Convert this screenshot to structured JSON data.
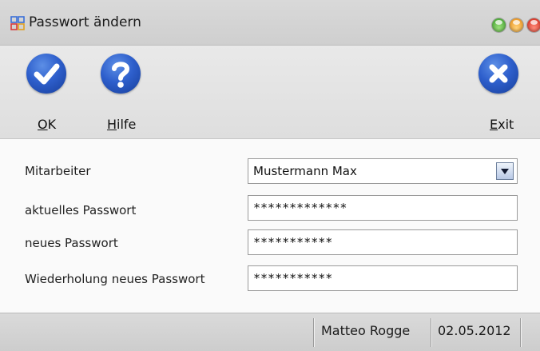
{
  "window": {
    "title": "Passwort ändern"
  },
  "toolbar": {
    "ok": {
      "mnemonic": "O",
      "rest": "K",
      "icon": "checkmark-icon"
    },
    "help": {
      "mnemonic": "H",
      "rest": "ilfe",
      "icon": "question-icon"
    },
    "exit": {
      "mnemonic": "E",
      "rest": "xit",
      "icon": "close-icon"
    }
  },
  "form": {
    "employee_label": "Mitarbeiter",
    "employee_value": "Mustermann Max",
    "current_password_label": "aktuelles Passwort",
    "current_password_value": "*************",
    "new_password_label": "neues Passwort",
    "new_password_value": "***********",
    "repeat_password_label": "Wiederholung neues Passwort",
    "repeat_password_value": "***********"
  },
  "status": {
    "user": "Matteo Rogge",
    "date": "02.05.2012"
  },
  "colors": {
    "icon_blue": "#2e5fcc",
    "close_green": "#3a9d2a",
    "close_orange": "#e88b12",
    "close_red": "#cf2416"
  }
}
